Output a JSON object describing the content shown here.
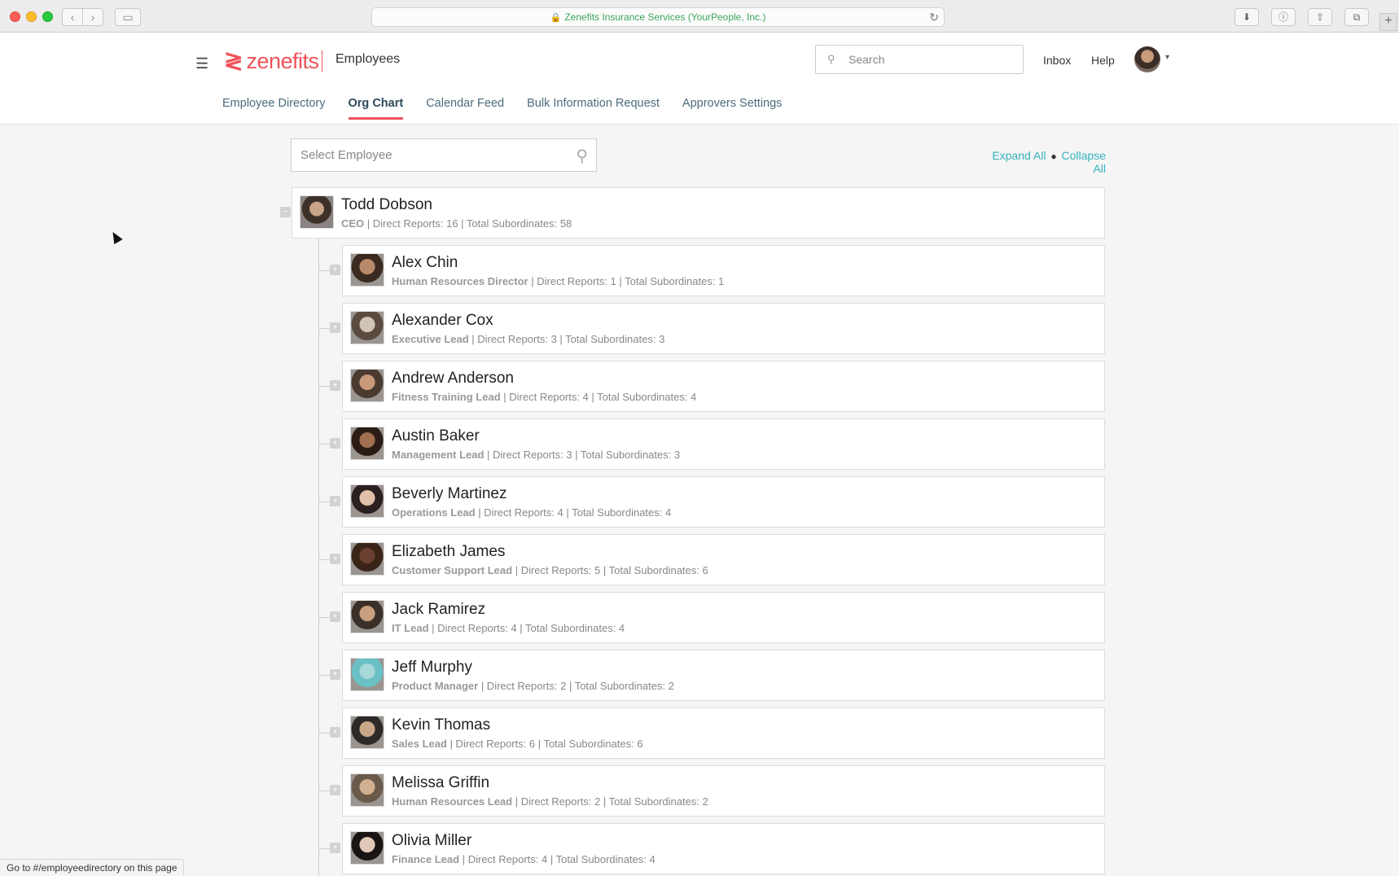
{
  "browser": {
    "url_text": "Zenefits Insurance Services (YourPeople, Inc.)",
    "status_text": "Go to #/employeedirectory on this page"
  },
  "header": {
    "logo_text": "zenefits",
    "app_title": "Employees",
    "search_placeholder": "Search",
    "inbox_label": "Inbox",
    "help_label": "Help"
  },
  "tabs": [
    {
      "label": "Employee Directory"
    },
    {
      "label": "Org Chart",
      "active": true
    },
    {
      "label": "Calendar Feed"
    },
    {
      "label": "Bulk Information Request"
    },
    {
      "label": "Approvers Settings"
    }
  ],
  "org": {
    "select_placeholder": "Select Employee",
    "expand_all": "Expand All",
    "collapse_all": "Collapse All",
    "root": {
      "name": "Todd Dobson",
      "title": "CEO",
      "details": "| Direct Reports: 16 | Total Subordinates: 58"
    },
    "reports": [
      {
        "name": "Alex Chin",
        "title": "Human Resources Director",
        "details": "| Direct Reports: 1 | Total Subordinates: 1"
      },
      {
        "name": "Alexander Cox",
        "title": "Executive Lead",
        "details": "| Direct Reports: 3 | Total Subordinates: 3"
      },
      {
        "name": "Andrew Anderson",
        "title": "Fitness Training Lead",
        "details": "| Direct Reports: 4 | Total Subordinates: 4"
      },
      {
        "name": "Austin Baker",
        "title": "Management Lead",
        "details": "| Direct Reports: 3 | Total Subordinates: 3"
      },
      {
        "name": "Beverly Martinez",
        "title": "Operations Lead",
        "details": "| Direct Reports: 4 | Total Subordinates: 4"
      },
      {
        "name": "Elizabeth James",
        "title": "Customer Support Lead",
        "details": "| Direct Reports: 5 | Total Subordinates: 6"
      },
      {
        "name": "Jack Ramirez",
        "title": "IT Lead",
        "details": "| Direct Reports: 4 | Total Subordinates: 4"
      },
      {
        "name": "Jeff Murphy",
        "title": "Product Manager",
        "details": "| Direct Reports: 2 | Total Subordinates: 2"
      },
      {
        "name": "Kevin Thomas",
        "title": "Sales Lead",
        "details": "| Direct Reports: 6 | Total Subordinates: 6"
      },
      {
        "name": "Melissa Griffin",
        "title": "Human Resources Lead",
        "details": "| Direct Reports: 2 | Total Subordinates: 2"
      },
      {
        "name": "Olivia Miller",
        "title": "Finance Lead",
        "details": "| Direct Reports: 4 | Total Subordinates: 4"
      }
    ]
  },
  "colors": {
    "brand": "#f0535a",
    "link": "#34b3bc"
  }
}
